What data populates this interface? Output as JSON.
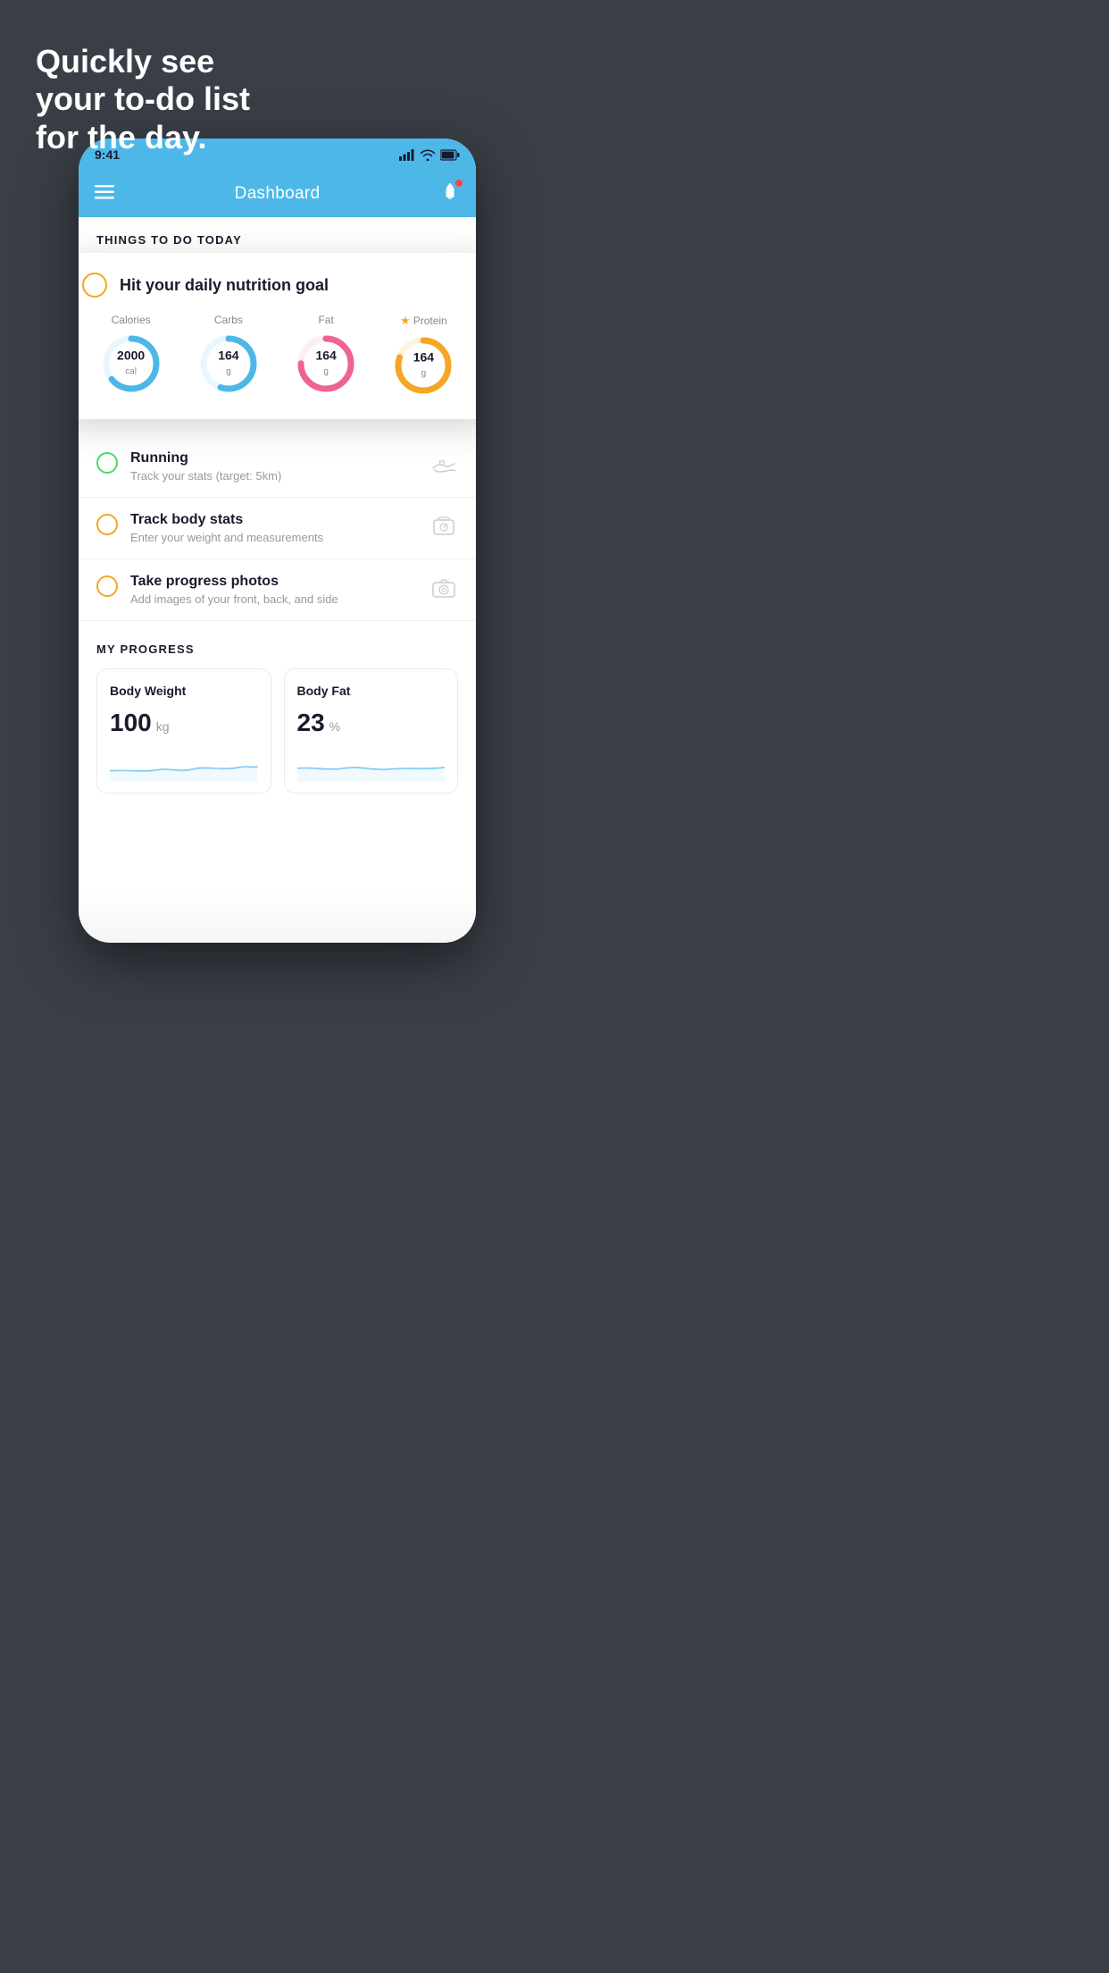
{
  "hero": {
    "line1": "Quickly see",
    "line2": "your to-do list",
    "line3": "for the day."
  },
  "phone": {
    "statusBar": {
      "time": "9:41",
      "signal": "▋▋▋▋",
      "wifi": "wifi",
      "battery": "battery"
    },
    "navbar": {
      "title": "Dashboard"
    },
    "sectionTitle": "THINGS TO DO TODAY",
    "card": {
      "title": "Hit your daily nutrition goal",
      "nutrition": [
        {
          "label": "Calories",
          "value": "2000",
          "unit": "cal",
          "color": "#4db8e8",
          "progress": 65,
          "starred": false
        },
        {
          "label": "Carbs",
          "value": "164",
          "unit": "g",
          "color": "#4db8e8",
          "progress": 55,
          "starred": false
        },
        {
          "label": "Fat",
          "value": "164",
          "unit": "g",
          "color": "#f06292",
          "progress": 75,
          "starred": false
        },
        {
          "label": "Protein",
          "value": "164",
          "unit": "g",
          "color": "#f5a623",
          "progress": 80,
          "starred": true
        }
      ]
    },
    "todoItems": [
      {
        "title": "Running",
        "subtitle": "Track your stats (target: 5km)",
        "circleColor": "green",
        "iconType": "shoe"
      },
      {
        "title": "Track body stats",
        "subtitle": "Enter your weight and measurements",
        "circleColor": "yellow",
        "iconType": "scale"
      },
      {
        "title": "Take progress photos",
        "subtitle": "Add images of your front, back, and side",
        "circleColor": "yellow",
        "iconType": "photo"
      }
    ],
    "progressSection": {
      "title": "MY PROGRESS",
      "cards": [
        {
          "title": "Body Weight",
          "value": "100",
          "unit": "kg"
        },
        {
          "title": "Body Fat",
          "value": "23",
          "unit": "%"
        }
      ]
    }
  }
}
